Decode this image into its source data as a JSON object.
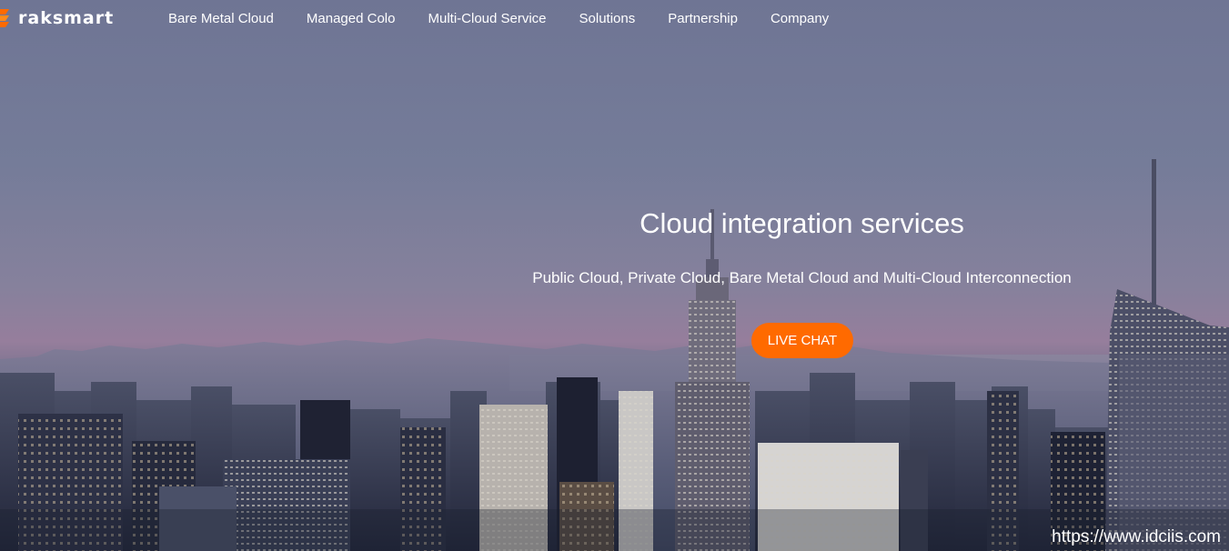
{
  "brand": {
    "name": "raksmart",
    "accent": "#ff6a00",
    "logo_icon": "raksmart-logo-icon"
  },
  "nav": {
    "items": [
      {
        "label": "Bare Metal Cloud"
      },
      {
        "label": "Managed Colo"
      },
      {
        "label": "Multi-Cloud Service"
      },
      {
        "label": "Solutions"
      },
      {
        "label": "Partnership"
      },
      {
        "label": "Company"
      }
    ]
  },
  "hero": {
    "title": "Cloud integration services",
    "subtitle": "Public Cloud, Private Cloud, Bare Metal Cloud and Multi-Cloud Interconnection",
    "cta_label": "LIVE CHAT",
    "background": "city-skyline-photo"
  },
  "watermark": "https://www.idciis.com"
}
